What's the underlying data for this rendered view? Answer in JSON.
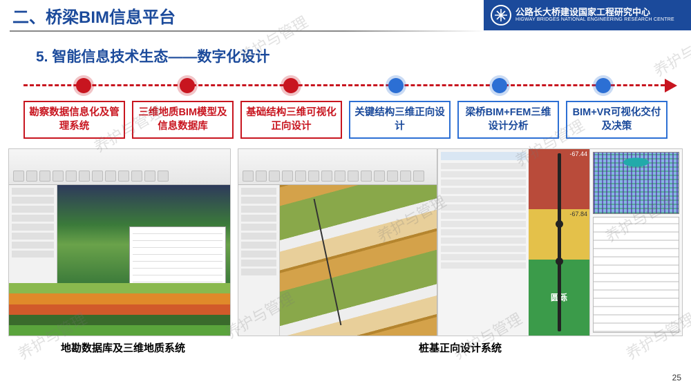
{
  "header": {
    "section_title": "二、桥梁BIM信息平台",
    "org_cn": "公路长大桥建设国家工程研究中心",
    "org_en": "HIGWAY BRIDGES NATIONAL ENGINEERING RESEARCH CENTRE"
  },
  "subtitle": "5. 智能信息技术生态——数字化设计",
  "timeline_boxes": [
    {
      "text": "勘察数据信息化及管理系统",
      "tone": "red"
    },
    {
      "text": "三维地质BIM模型及信息数据库",
      "tone": "red"
    },
    {
      "text": "基础结构三维可视化正向设计",
      "tone": "red"
    },
    {
      "text": "关键结构三维正向设计",
      "tone": "blue"
    },
    {
      "text": "梁桥BIM+FEM三维设计分析",
      "tone": "blue"
    },
    {
      "text": "BIM+VR可视化交付及决策",
      "tone": "blue"
    }
  ],
  "captions": {
    "left": "地勘数据库及三维地质系统",
    "right": "桩基正向设计系统"
  },
  "soil_labels": {
    "top": "-67.44",
    "mid": "-67.84",
    "bottom": "圆砾"
  },
  "watermark_text": "养护与管理",
  "page_number": "25"
}
